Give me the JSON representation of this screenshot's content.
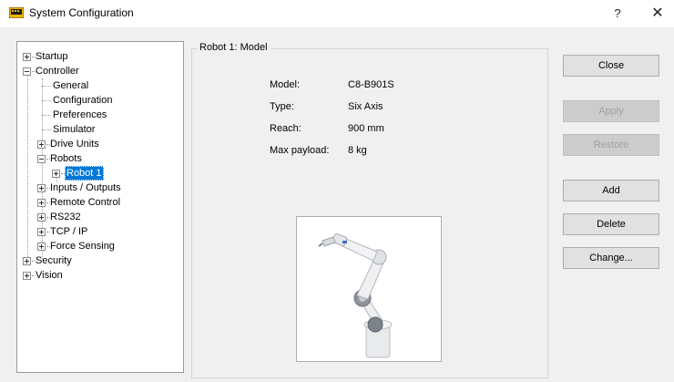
{
  "window": {
    "title": "System Configuration",
    "help_glyph": "?",
    "close_glyph": "✕",
    "icon": "monitor-icon"
  },
  "tree": {
    "items": [
      {
        "label": "Startup",
        "expander": "plus"
      },
      {
        "label": "Controller",
        "expander": "minus"
      },
      {
        "label": "General",
        "expander": "none"
      },
      {
        "label": "Configuration",
        "expander": "none"
      },
      {
        "label": "Preferences",
        "expander": "none"
      },
      {
        "label": "Simulator",
        "expander": "none"
      },
      {
        "label": "Drive Units",
        "expander": "plus"
      },
      {
        "label": "Robots",
        "expander": "minus"
      },
      {
        "label": "Robot 1",
        "expander": "plus",
        "selected": true
      },
      {
        "label": "Inputs / Outputs",
        "expander": "plus"
      },
      {
        "label": "Remote Control",
        "expander": "plus"
      },
      {
        "label": "RS232",
        "expander": "plus"
      },
      {
        "label": "TCP / IP",
        "expander": "plus"
      },
      {
        "label": "Force Sensing",
        "expander": "plus"
      },
      {
        "label": "Security",
        "expander": "plus"
      },
      {
        "label": "Vision",
        "expander": "plus"
      }
    ]
  },
  "panel": {
    "group_title": "Robot 1: Model",
    "properties": [
      {
        "label": "Model:",
        "value": "C8-B901S"
      },
      {
        "label": "Type:",
        "value": "Six Axis"
      },
      {
        "label": "Reach:",
        "value": "900 mm"
      },
      {
        "label": "Max payload:",
        "value": "8 kg"
      }
    ],
    "image": "robot-arm-image"
  },
  "buttons": {
    "close": {
      "label": "Close",
      "enabled": true
    },
    "apply": {
      "label": "Apply",
      "enabled": false
    },
    "restore": {
      "label": "Restore",
      "enabled": false
    },
    "add": {
      "label": "Add",
      "enabled": true
    },
    "delete": {
      "label": "Delete",
      "enabled": true
    },
    "change": {
      "label": "Change...",
      "enabled": true
    }
  },
  "colors": {
    "selection": "#0078d7",
    "window_bg": "#f0f0f0",
    "titlebar_bg": "#ffffff"
  }
}
